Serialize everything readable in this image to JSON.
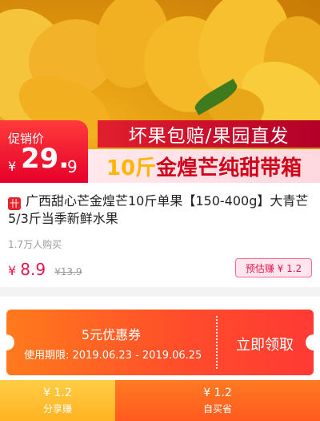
{
  "hero": {
    "price_label": "促销价",
    "currency": "¥",
    "price_int": "29.",
    "price_dec": "9",
    "promo_line1": "坏果包赔/果园直发",
    "promo_line2_num": "10斤",
    "promo_line2_text": "金煌芒纯甜带箱"
  },
  "product": {
    "shop_badge": "卄",
    "title": "广西甜心芒金煌芒10斤单果【150-400g】大青芒5/3斤当季新鲜水果",
    "sold": "1.7万人购买",
    "currency": "¥",
    "price": "8.9",
    "original_price": "¥13.9",
    "estimate": "预估赚 ¥ 1.2"
  },
  "coupon": {
    "title": "5元优惠券",
    "period": "使用期限: 2019.06.23 - 2019.06.25",
    "claim": "立即领取"
  },
  "bottom": {
    "share_amount": "¥ 1.2",
    "share_label": "分享赚",
    "buy_amount": "¥ 1.2",
    "buy_label": "自买省"
  },
  "colors": {
    "accent": "#e5164e",
    "coupon": "#ff4b2b",
    "share": "#ffb322",
    "buy": "#ff5a1f"
  }
}
